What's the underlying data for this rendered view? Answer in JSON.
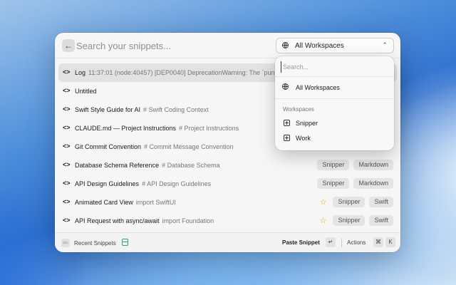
{
  "search": {
    "placeholder": "Search your snippets...",
    "back_icon": "arrow-left-icon"
  },
  "workspace_select": {
    "label": "All Workspaces",
    "icon": "globe-icon",
    "chevron": "⌃"
  },
  "snippets": [
    {
      "title": "Log",
      "subtitle": "11:37:01 (node:40457) [DEP0040] DeprecationWarning: The `punycode`",
      "tags": [],
      "starred": false
    },
    {
      "title": "Untitled",
      "subtitle": "",
      "tags": [],
      "starred": false
    },
    {
      "title": "Swift Style Guide for AI",
      "subtitle": "# Swift Coding Context",
      "tags": [],
      "starred": false
    },
    {
      "title": "CLAUDE.md — Project Instructions",
      "subtitle": "# Project Instructions",
      "tags": [],
      "starred": false
    },
    {
      "title": "Git Commit Convention",
      "subtitle": "# Commit Message Convention",
      "tags": [],
      "starred": false
    },
    {
      "title": "Database Schema Reference",
      "subtitle": "# Database Schema",
      "tags": [
        "Snipper",
        "Markdown"
      ],
      "starred": false
    },
    {
      "title": "API Design Guidelines",
      "subtitle": "# API Design Guidelines",
      "tags": [
        "Snipper",
        "Markdown"
      ],
      "starred": false
    },
    {
      "title": "Animated Card View",
      "subtitle": "import SwiftUI",
      "tags": [
        "Snipper",
        "Swift"
      ],
      "starred": true
    },
    {
      "title": "API Request with async/await",
      "subtitle": "import Foundation",
      "tags": [
        "Snipper",
        "Swift"
      ],
      "starred": true
    }
  ],
  "row_icon": "<>",
  "star_glyph": "☆",
  "dropdown": {
    "search_placeholder": "Search...",
    "all_label": "All Workspaces",
    "section_label": "Workspaces",
    "items": [
      {
        "label": "Snipper",
        "active": true
      },
      {
        "label": "Work",
        "active": false
      }
    ]
  },
  "footer": {
    "logo_text": "esc",
    "recent_label": "Recent Snippets",
    "paste_label": "Paste Snippet",
    "enter_key": "↵",
    "actions_label": "Actions",
    "cmd_key": "⌘",
    "k_key": "K"
  },
  "colors": {
    "star": "#d9a400",
    "db_icon": "#2fa86a"
  }
}
